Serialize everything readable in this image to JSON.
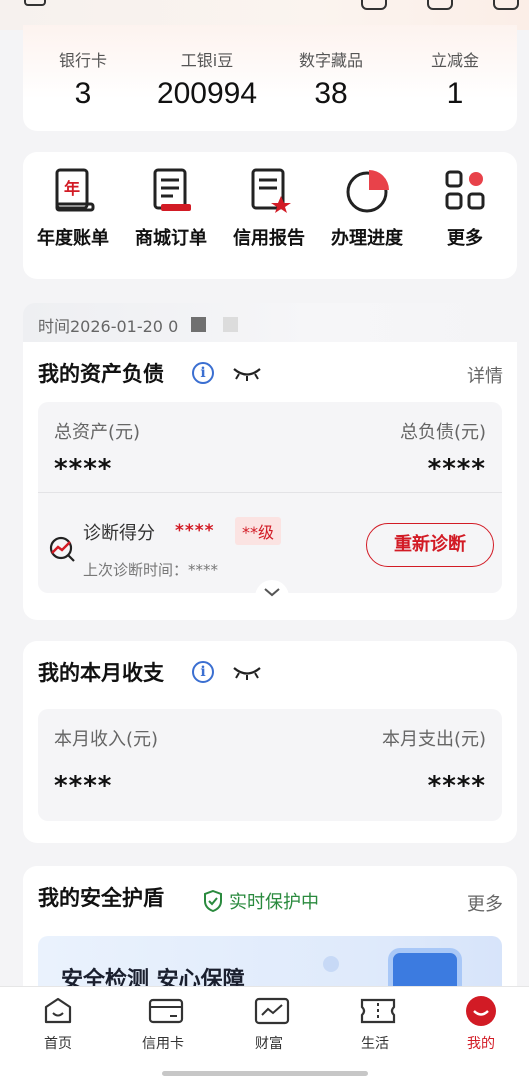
{
  "stats": [
    {
      "label": "银行卡",
      "value": "3"
    },
    {
      "label": "工银i豆",
      "value": "200994"
    },
    {
      "label": "数字藏品",
      "value": "38"
    },
    {
      "label": "立减金",
      "value": "1"
    }
  ],
  "shortcuts": [
    {
      "label": "年度账单",
      "icon": "annual-bill-icon"
    },
    {
      "label": "商城订单",
      "icon": "mall-order-icon"
    },
    {
      "label": "信用报告",
      "icon": "credit-report-icon"
    },
    {
      "label": "办理进度",
      "icon": "progress-icon"
    },
    {
      "label": "更多",
      "icon": "more-grid-icon"
    }
  ],
  "timebar": {
    "text": "时间2026-01-20 0"
  },
  "assets": {
    "title": "我的资产负债",
    "detail": "详情",
    "total_assets_label": "总资产(元)",
    "total_liabilities_label": "总负债(元)",
    "total_assets_value": "****",
    "total_liabilities_value": "****",
    "diagnosis_label": "诊断得分",
    "diagnosis_score": "****",
    "diagnosis_grade": "**级",
    "last_diagnosis": "上次诊断时间：****",
    "rediagnose_button": "重新诊断"
  },
  "budget": {
    "title": "我的本月收支",
    "income_label": "本月收入(元)",
    "expense_label": "本月支出(元)",
    "income_value": "****",
    "expense_value": "****"
  },
  "security": {
    "title": "我的安全护盾",
    "status": "实时保护中",
    "more": "更多",
    "banner_title": "安全检测 安心保障"
  },
  "tabbar": [
    {
      "label": "首页",
      "icon": "home-icon"
    },
    {
      "label": "信用卡",
      "icon": "credit-card-icon"
    },
    {
      "label": "财富",
      "icon": "wealth-chart-icon"
    },
    {
      "label": "生活",
      "icon": "ticket-icon"
    },
    {
      "label": "我的",
      "icon": "profile-icon",
      "active": true
    }
  ],
  "colors": {
    "accent": "#d21b25",
    "info": "#3b6fd1",
    "safe": "#2a8a3e"
  }
}
